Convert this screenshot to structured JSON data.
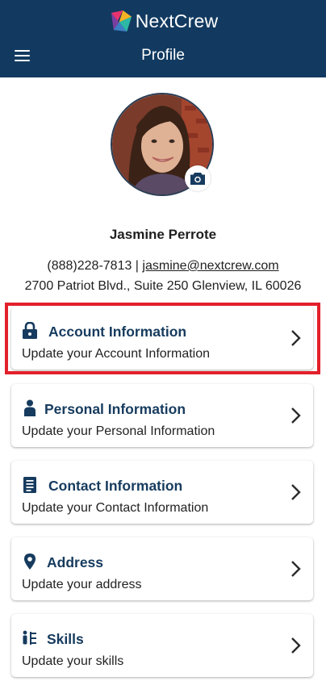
{
  "header": {
    "brand_name": "NextCrew",
    "title": "Profile",
    "background_color": "#123a60"
  },
  "profile": {
    "name": "Jasmine Perrote",
    "phone": "(888)228-7813",
    "separator": " | ",
    "email": "jasmine@nextcrew.com",
    "address": "2700 Patriot Blvd., Suite 250 Glenview, IL 60026"
  },
  "sections": [
    {
      "icon": "lock-icon",
      "title": "Account Information",
      "subtitle": "Update your Account Information"
    },
    {
      "icon": "person-icon",
      "title": "Personal Information",
      "subtitle": "Update your Personal Information"
    },
    {
      "icon": "document-icon",
      "title": "Contact Information",
      "subtitle": "Update your Contact Information"
    },
    {
      "icon": "location-pin-icon",
      "title": "Address",
      "subtitle": "Update your address"
    },
    {
      "icon": "skills-icon",
      "title": "Skills",
      "subtitle": "Update your skills"
    }
  ],
  "colors": {
    "accent_text": "#163b5e",
    "highlight": "#e3202b"
  }
}
